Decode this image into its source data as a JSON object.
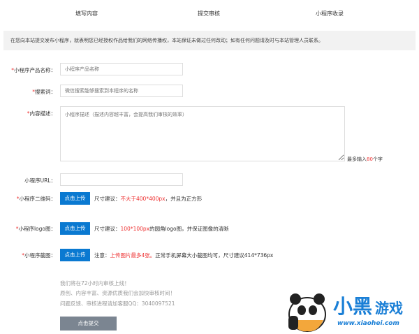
{
  "steps": [
    "填写内容",
    "提交审核",
    "小程序收录"
  ],
  "notice": "在您向本站提交发布小程序，就表明您已经授权作品给我们的网络传播权，本站保证未做过任何改动；如有任何问题请及时与本站管理人员联系。",
  "form": {
    "name": {
      "label": "小程序产品名称：",
      "placeholder": "小程序产品名称"
    },
    "keywords": {
      "label": "搜索词：",
      "placeholder": "微信搜索能够搜索到本程序的名称"
    },
    "desc": {
      "label": "内容描述：",
      "placeholder": "小程序描述（描述内容越丰富，会提高我们审核的效率）",
      "limit_prefix": "最多输入",
      "limit_num": "80",
      "limit_suffix": "个字"
    },
    "url": {
      "label": "小程序URL：",
      "value": ""
    },
    "qrcode": {
      "label": "小程序二维码：",
      "button": "点击上传",
      "hint_prefix": "尺寸建议：",
      "hint_red": "不大于400*400px",
      "hint_suffix": "，并且为正方形"
    },
    "logo": {
      "label": "小程序logo图：",
      "button": "点击上传",
      "hint_prefix": "尺寸建议：",
      "hint_red": "100*100px",
      "hint_suffix": "的圆角logo图，并保证图像的清晰"
    },
    "screens": {
      "label": "小程序截图：",
      "button": "点击上传",
      "hint_prefix": "注意：",
      "hint_red": "上传图片最多4张。",
      "hint_suffix": "正常手机屏幕大小截图均可，尺寸建议414*736px"
    }
  },
  "notes": [
    "我们将在72小时内审核上线！",
    "原创、内容丰富、资源优质我们会加快审核时间！",
    "问题反馈、审核进程请加客服QQ：3040097521"
  ],
  "submit": "点击提交",
  "watermark": {
    "title": "小黑游戏",
    "url": "www.xiaohei.com"
  },
  "colors": {
    "accent": "#0a79d1",
    "required": "#e33333",
    "submit": "#7b8591"
  }
}
